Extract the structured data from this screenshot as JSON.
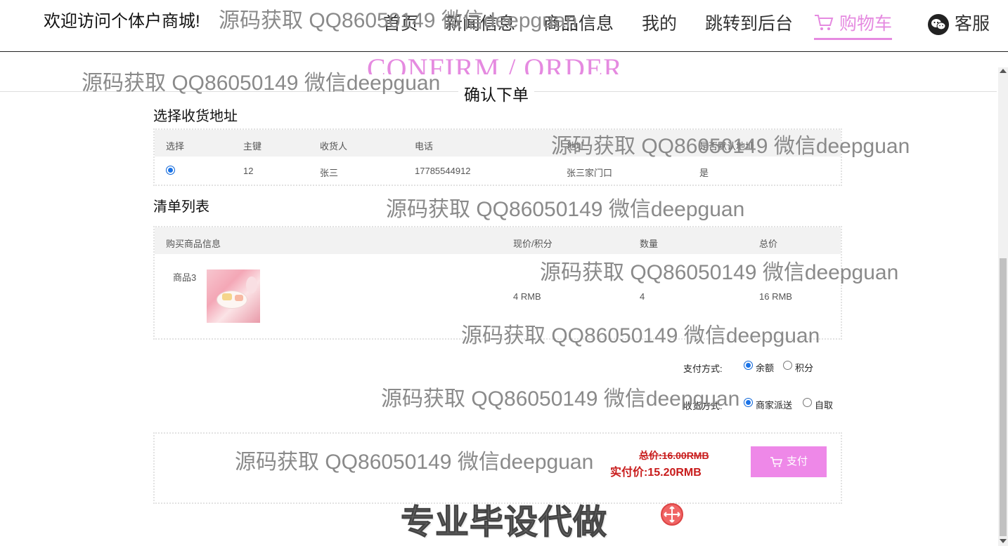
{
  "header": {
    "welcome": "欢迎访问个体户商城!",
    "nav": [
      {
        "label": "首页"
      },
      {
        "label": "新闻信息"
      },
      {
        "label": "商品信息"
      },
      {
        "label": "我的"
      },
      {
        "label": "跳转到后台"
      },
      {
        "label": "购物车"
      },
      {
        "label": "客服"
      }
    ]
  },
  "page": {
    "title_en": "CONFIRM / ORDER",
    "title_cn": "确认下单"
  },
  "address": {
    "section_title": "选择收货地址",
    "columns": [
      "选择",
      "主键",
      "收货人",
      "电话",
      "地址",
      "是否默认地址"
    ],
    "rows": [
      {
        "selected": true,
        "id": "12",
        "receiver": "张三",
        "phone": "17785544912",
        "address": "张三家门口",
        "is_default": "是"
      }
    ]
  },
  "items": {
    "section_title": "清单列表",
    "columns": [
      "购买商品信息",
      "现价/积分",
      "数量",
      "总价"
    ],
    "rows": [
      {
        "name": "商品3",
        "price": "4 RMB",
        "quantity": "4",
        "total": "16 RMB"
      }
    ]
  },
  "payment": {
    "label": "支付方式:",
    "options": [
      {
        "label": "余额",
        "selected": true
      },
      {
        "label": "积分",
        "selected": false
      }
    ]
  },
  "delivery": {
    "label": "收货方式:",
    "options": [
      {
        "label": "商家派送",
        "selected": true
      },
      {
        "label": "自取",
        "selected": false
      }
    ]
  },
  "summary": {
    "total": "总价:16.00RMB",
    "actual": "实付价:15.20RMB",
    "pay_label": "支付"
  },
  "watermarks": [
    "源码获取 QQ86050149 微信deepguan",
    "源码获取 QQ86050149 微信deepguan",
    "源码获取 QQ86050149 微信deepguan",
    "源码获取 QQ86050149 微信deepguan",
    "源码获取 QQ86050149 微信deepguan",
    "源码获取 QQ86050149 微信deepguan",
    "源码获取 QQ86050149 微信deepguan",
    "源码获取 QQ86050149 微信deepguan"
  ],
  "promo": "专业毕设代做",
  "colors": {
    "accent": "#e58ae0",
    "pay_button": "#ee88e8",
    "price": "#c81b1b",
    "watermark": "#8a8a8a"
  },
  "icons": [
    "cart-icon",
    "wechat-icon",
    "move-icon"
  ]
}
